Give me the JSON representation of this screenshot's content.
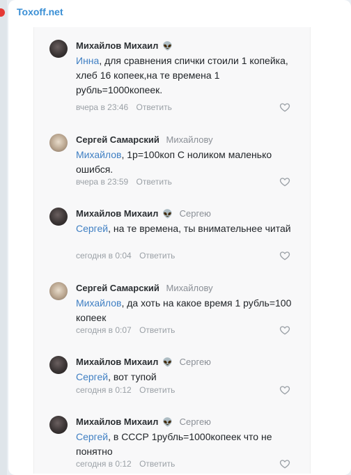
{
  "channel": {
    "title": "Toxoff.net"
  },
  "comments": [
    {
      "author": "Михайлов Михаил",
      "reply_to": "",
      "mention": "Инна",
      "text": ", для сравнения спички стоили 1 копейка, хлеб 16 копеек,на те времена 1 рубль=1000копеек.",
      "time": "вчера в 23:46",
      "reply_label": "Ответить",
      "avatar": "dark",
      "alien": true
    },
    {
      "author": "Сергей Самарский",
      "reply_to": "Михайлову",
      "mention": "Михайлов",
      "text": ", 1р=100коп С ноликом маленько ошибся.",
      "time": "вчера в 23:59",
      "reply_label": "Ответить",
      "avatar": "light",
      "alien": false
    },
    {
      "author": "Михайлов Михаил",
      "reply_to": "Сергею",
      "mention": "Сергей",
      "text": ", на те времена, ты внимательнее читай",
      "time": "сегодня в 0:04",
      "reply_label": "Ответить",
      "avatar": "dark",
      "alien": true
    },
    {
      "author": "Сергей Самарский",
      "reply_to": "Михайлову",
      "mention": "Михайлов",
      "text": ", да хоть на какое время 1 рубль=100 копеек",
      "time": "сегодня в 0:07",
      "reply_label": "Ответить",
      "avatar": "light",
      "alien": false
    },
    {
      "author": "Михайлов Михаил",
      "reply_to": "Сергею",
      "mention": "Сергей",
      "text": ", вот тупой",
      "time": "сегодня в 0:12",
      "reply_label": "Ответить",
      "avatar": "dark",
      "alien": true
    },
    {
      "author": "Михайлов Михаил",
      "reply_to": "Сергею",
      "mention": "Сергей",
      "text": ", в СССР 1рубль=1000копеек что не понятно",
      "time": "сегодня в 0:12",
      "reply_label": "Ответить",
      "avatar": "dark",
      "alien": true
    }
  ]
}
